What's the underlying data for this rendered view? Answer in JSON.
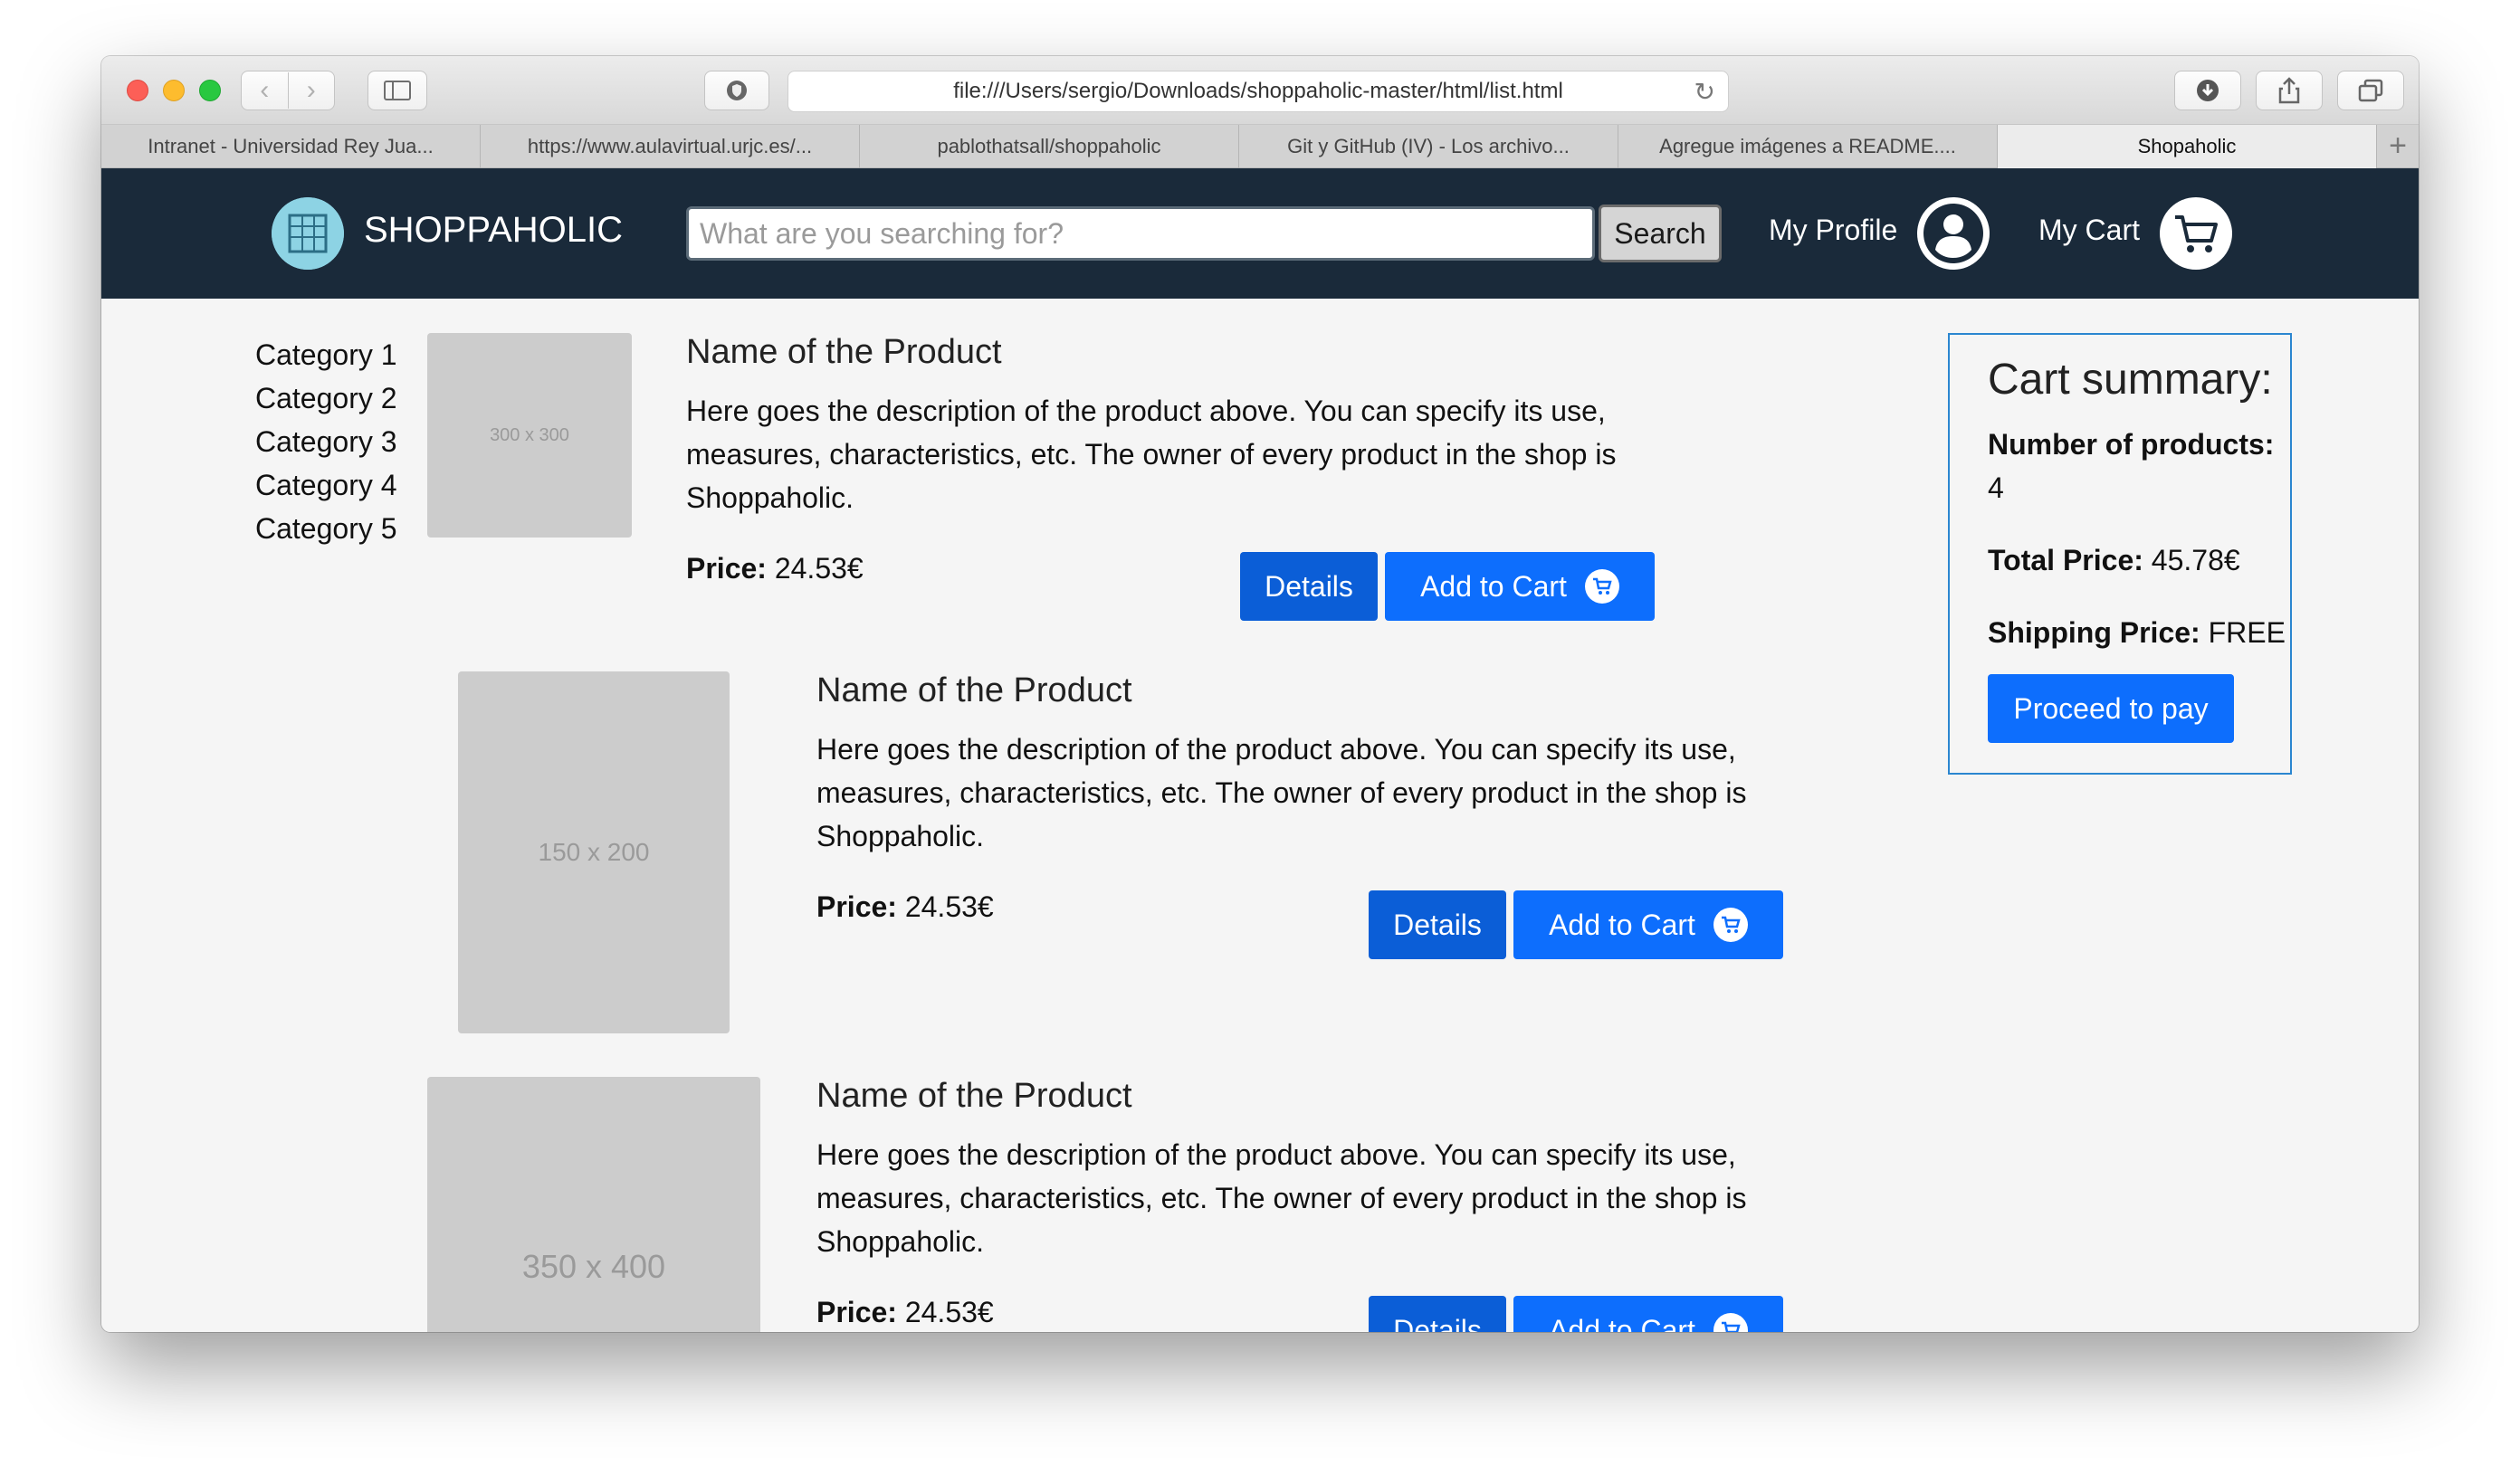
{
  "browser": {
    "url": "file:///Users/sergio/Downloads/shoppaholic-master/html/list.html",
    "tabs": [
      {
        "label": "Intranet - Universidad Rey Jua..."
      },
      {
        "label": "https://www.aulavirtual.urjc.es/..."
      },
      {
        "label": "pablothatsall/shoppaholic"
      },
      {
        "label": "Git y GitHub (IV) - Los archivo..."
      },
      {
        "label": "Agregue imágenes a README...."
      },
      {
        "label": "Shopaholic"
      }
    ],
    "new_tab_label": "+"
  },
  "navbar": {
    "brand": "SHOPPAHOLIC",
    "search_placeholder": "What are you searching for?",
    "search_button": "Search",
    "profile_label": "My Profile",
    "cart_label": "My Cart"
  },
  "categories": [
    "Category 1",
    "Category 2",
    "Category 3",
    "Category 4",
    "Category 5"
  ],
  "products": [
    {
      "image_label": "300 x 300",
      "title": "Name of the Product",
      "description": "Here goes the description of the product above. You can specify its use, measures, characteristics, etc. The owner of every product in the shop is Shoppaholic.",
      "price_label": "Price:",
      "price": "24.53€",
      "details_label": "Details",
      "add_label": "Add to Cart"
    },
    {
      "image_label": "150 x 200",
      "title": "Name of the Product",
      "description": "Here goes the description of the product above. You can specify its use, measures, characteristics, etc. The owner of every product in the shop is Shoppaholic.",
      "price_label": "Price:",
      "price": "24.53€",
      "details_label": "Details",
      "add_label": "Add to Cart"
    },
    {
      "image_label": "350 x 400",
      "title": "Name of the Product",
      "description": "Here goes the description of the product above. You can specify its use, measures, characteristics, etc. The owner of every product in the shop is Shoppaholic.",
      "price_label": "Price:",
      "price": "24.53€",
      "details_label": "Details",
      "add_label": "Add to Cart"
    }
  ],
  "summary": {
    "title": "Cart summary:",
    "num_label": "Number of products:",
    "num_value": "4",
    "total_label": "Total Price:",
    "total_value": "45.78€",
    "shipping_label": "Shipping Price:",
    "shipping_value": "FREE",
    "proceed_label": "Proceed to pay"
  },
  "colors": {
    "navbar": "#1a2a3a",
    "primary": "#0d6efd",
    "summary_border": "#2b86d0"
  }
}
